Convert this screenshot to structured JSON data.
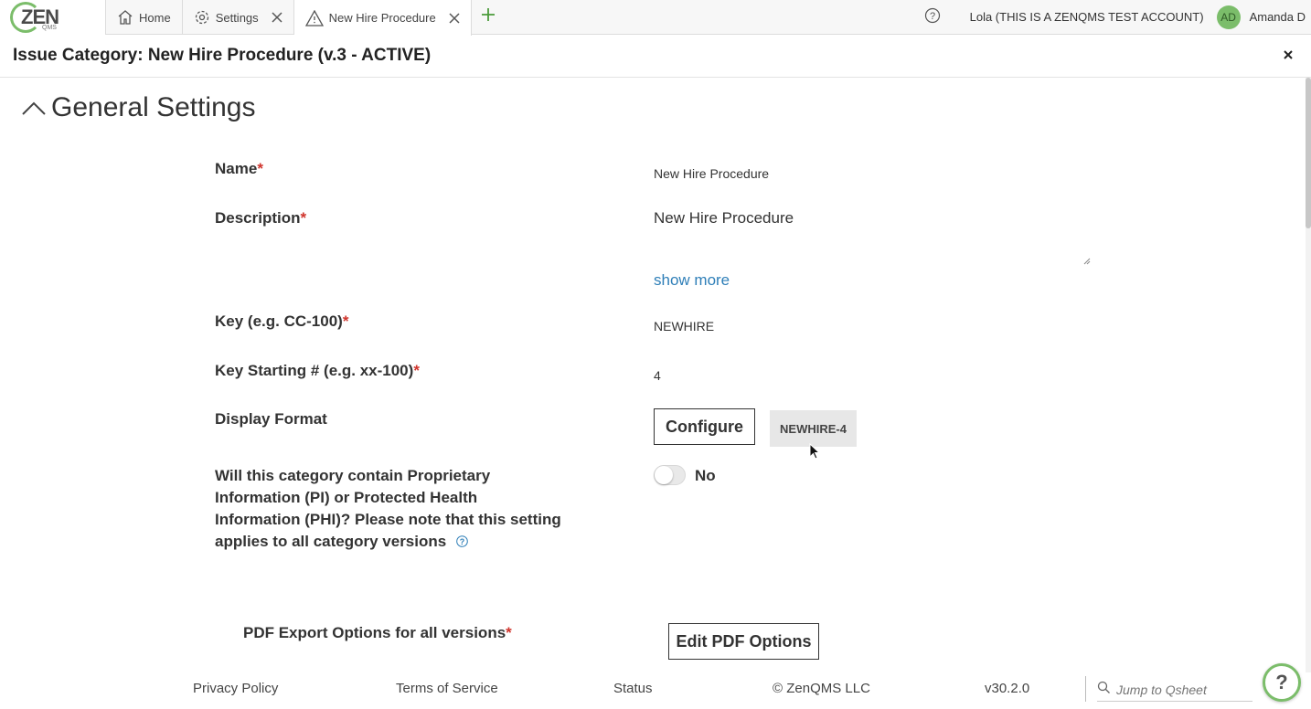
{
  "logo": {
    "text": "ZEN",
    "sub": "QMS"
  },
  "tabs": [
    {
      "label": "Home"
    },
    {
      "label": "Settings"
    },
    {
      "label": "New Hire Procedure"
    }
  ],
  "user": {
    "account": "Lola (THIS IS A ZENQMS TEST ACCOUNT)",
    "initials": "AD",
    "name": "Amanda D"
  },
  "header": {
    "title": "Issue Category: New Hire Procedure (v.3 - ACTIVE)"
  },
  "section": {
    "title": "General Settings"
  },
  "fields": {
    "name_label": "Name",
    "name_value": "New Hire Procedure",
    "description_label": "Description",
    "description_value": "New Hire Procedure",
    "show_more": "show more",
    "key_label": "Key (e.g. CC-100)",
    "key_value": "NEWHIRE",
    "key_start_label": "Key Starting # (e.g. xx-100)",
    "key_start_value": "4",
    "display_format_label": "Display Format",
    "configure_label": "Configure",
    "display_format_value": "NEWHIRE-4",
    "pi_question": "Will this category contain Proprietary Information (PI) or Protected Health Information (PHI)? Please note that this setting applies to all category versions",
    "pi_toggle_label": "No",
    "pdf_label": "PDF Export Options for all versions",
    "pdf_button": "Edit PDF Options",
    "required_mark": "*"
  },
  "footer": {
    "privacy": "Privacy Policy",
    "terms": "Terms of Service",
    "status": "Status",
    "copyright": "© ZenQMS LLC",
    "version": "v30.2.0",
    "jump_placeholder": "Jump to Qsheet",
    "help": "?"
  },
  "colors": {
    "brand_green": "#7bbd6a",
    "link_blue": "#2f7fb8",
    "required_red": "#d0342c"
  }
}
